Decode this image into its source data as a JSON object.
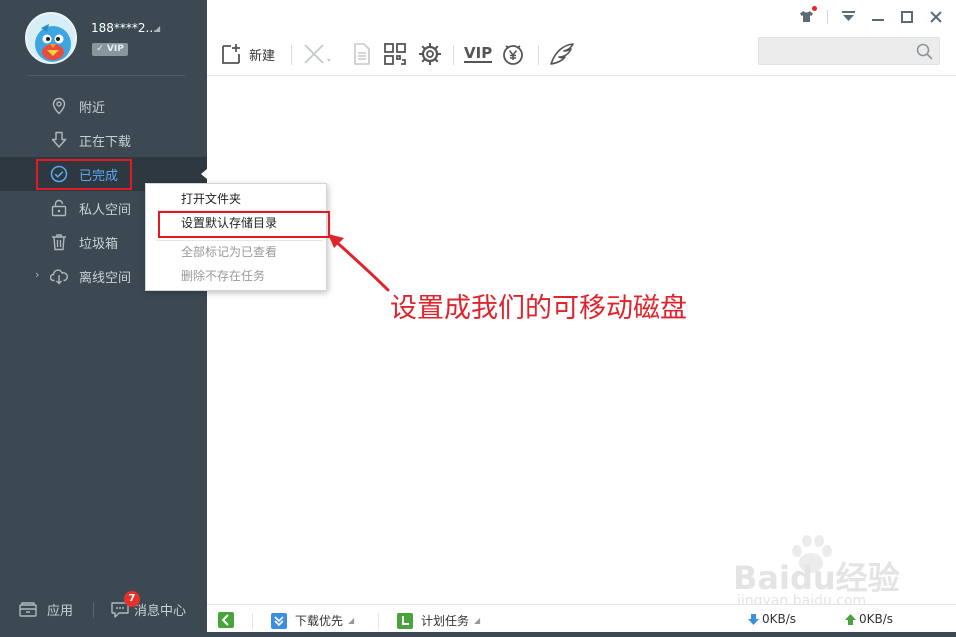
{
  "profile": {
    "username": "188****2...",
    "vip_label": "VIP"
  },
  "nav": {
    "items": [
      {
        "label": "附近",
        "icon": "location-pin-icon"
      },
      {
        "label": "正在下载",
        "icon": "download-arrow-icon"
      },
      {
        "label": "已完成",
        "icon": "check-circle-icon"
      },
      {
        "label": "私人空间",
        "icon": "lock-icon"
      },
      {
        "label": "垃圾箱",
        "icon": "trash-icon"
      },
      {
        "label": "离线空间",
        "icon": "cloud-download-icon"
      }
    ]
  },
  "sidebar_bottom": {
    "apps_label": "应用",
    "messages_label": "消息中心",
    "message_count": "7"
  },
  "toolbar": {
    "new_label": "新建",
    "vip_label": "VIP",
    "search_placeholder": ""
  },
  "context_menu": {
    "items": [
      {
        "label": "打开文件夹",
        "enabled": true
      },
      {
        "label": "设置默认存储目录",
        "enabled": true
      },
      {
        "label": "全部标记为已查看",
        "enabled": false
      },
      {
        "label": "删除不存在任务",
        "enabled": false
      }
    ]
  },
  "annotation": {
    "text": "设置成我们的可移动磁盘"
  },
  "statusbar": {
    "download_priority": "下载优先",
    "scheduled_tasks": "计划任务",
    "download_speed": "0KB/s",
    "upload_speed": "0KB/s"
  },
  "watermark": {
    "brand": "Baidu经验",
    "url": "jingyan.baidu.com"
  },
  "colors": {
    "sidebar": "#3c4953",
    "accent": "#5aa9f0",
    "annotation_red": "#e0242d",
    "status_green": "#48a33a"
  }
}
